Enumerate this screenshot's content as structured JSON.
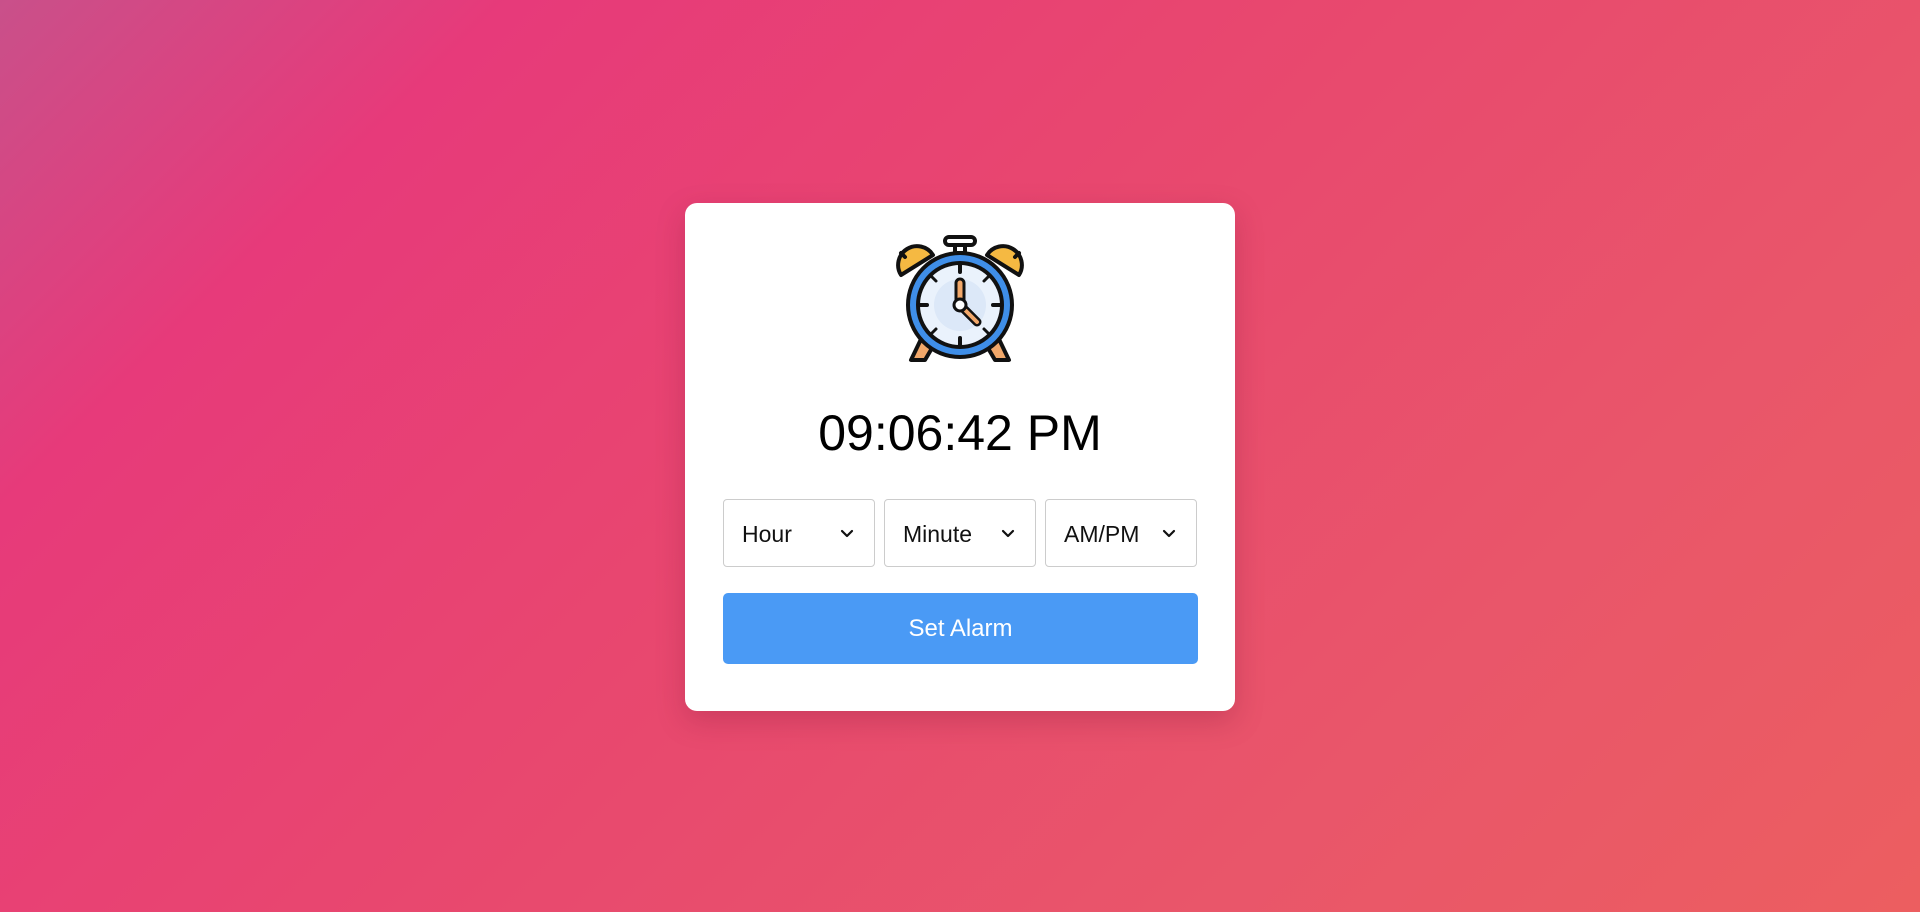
{
  "app": {
    "icon": "alarm-clock-icon"
  },
  "clock": {
    "time": "09:06:42 PM"
  },
  "alarm": {
    "hour_select": {
      "selected": "Hour",
      "icon": "chevron-down-icon"
    },
    "minute_select": {
      "selected": "Minute",
      "icon": "chevron-down-icon"
    },
    "ampm_select": {
      "selected": "AM/PM",
      "icon": "chevron-down-icon"
    },
    "button_label": "Set Alarm"
  },
  "colors": {
    "accent": "#4a9af5",
    "background_start": "#e73a7a",
    "background_end": "#ec5e60",
    "card": "#ffffff",
    "bell": "#f5b942",
    "clock_ring": "#3f8ee8"
  }
}
